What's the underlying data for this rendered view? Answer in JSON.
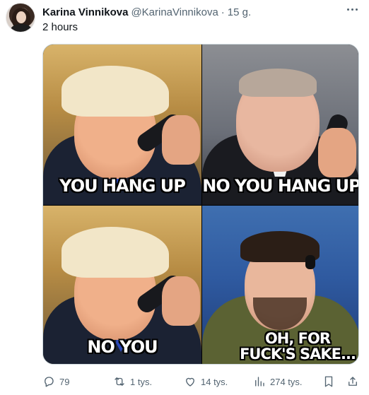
{
  "tweet": {
    "author_name": "Karina Vinnikova",
    "author_handle": "@KarinaVinnikova",
    "separator": "·",
    "timestamp": "15 g.",
    "text": "2 hours"
  },
  "media": {
    "panels": [
      {
        "caption": "YOU HANG UP"
      },
      {
        "caption": "NO YOU HANG UP"
      },
      {
        "caption": "NO YOU"
      },
      {
        "caption": "OH, FOR FUCK'S SAKE..."
      }
    ]
  },
  "actions": {
    "replies": "79",
    "reposts": "1 tys.",
    "likes": "14 tys.",
    "views": "274 tys."
  },
  "icons": {
    "more": "more-options-icon",
    "reply": "reply-icon",
    "repost": "repost-icon",
    "like": "heart-icon",
    "views": "analytics-icon",
    "bookmark": "bookmark-icon",
    "share": "share-icon"
  },
  "colors": {
    "text_primary": "#0f1419",
    "text_secondary": "#536471",
    "border": "#cfd9de"
  }
}
